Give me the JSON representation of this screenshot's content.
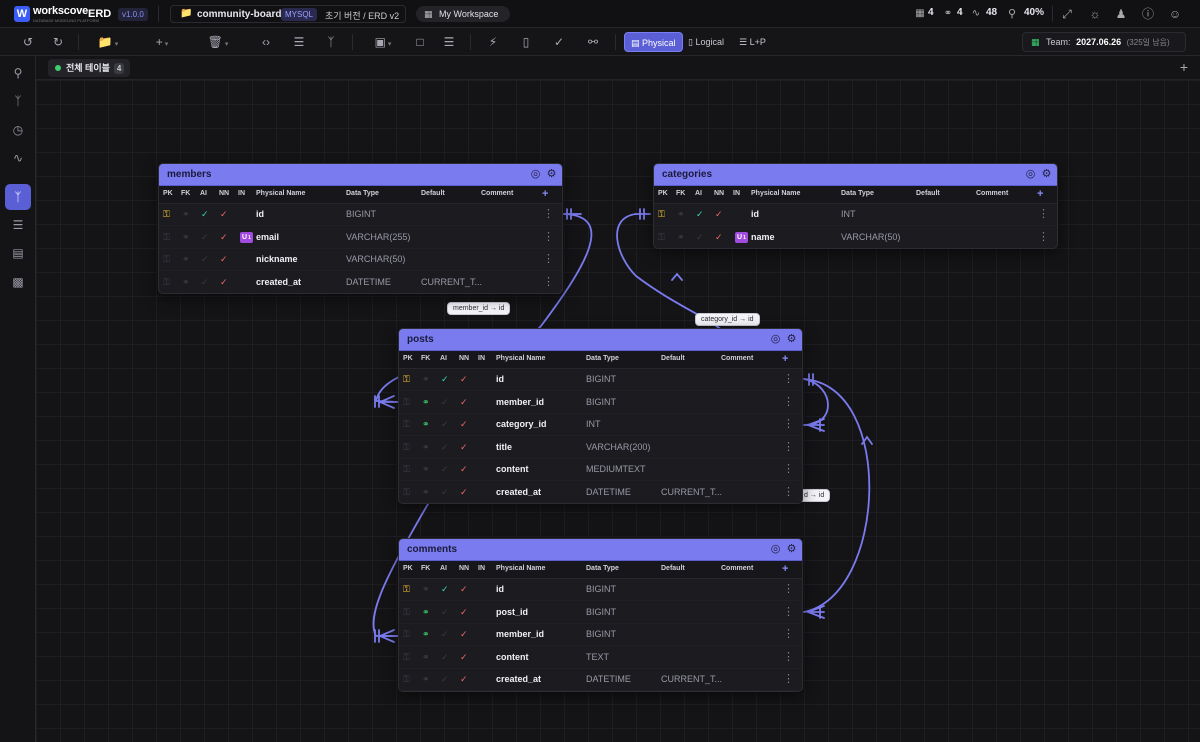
{
  "app": {
    "brand": "workscove",
    "brand_sub": "DATABASE MODELING PLATFORM",
    "erd": "ERD",
    "version": "v1.0.0"
  },
  "project": {
    "name": "community-board",
    "db": "MYSQL",
    "version": "초기 버전 / ERD v2",
    "workspace": "My Workspace"
  },
  "stats": {
    "tables": "4",
    "relations": "4",
    "activity": "48",
    "zoom": "40%"
  },
  "view_modes": [
    "Physical",
    "Logical",
    "L+P"
  ],
  "team": {
    "label": "Team:",
    "date": "2027.06.26",
    "remain": "(325일 남음)"
  },
  "tab": {
    "label": "전체 테이블",
    "count": "4"
  },
  "icons": {
    "pk": "key-icon",
    "fk": "link-icon",
    "check": "check-icon"
  },
  "colors": {
    "accent": "#7a7bef",
    "pk": "#f4c430",
    "fk": "#3ccf6e",
    "nn": "#f06a6a",
    "ai": "#3fd4b0"
  },
  "columns_header": [
    "PK",
    "FK",
    "AI",
    "NN",
    "IN",
    "Physical Name",
    "Data Type",
    "Default",
    "Comment"
  ],
  "relation_labels": [
    "member_id → id",
    "category_id → id",
    "d → id"
  ],
  "tables": {
    "members": {
      "name": "members",
      "rows": [
        {
          "name": "id",
          "type": "BIGINT",
          "default": ""
        },
        {
          "name": "email",
          "type": "VARCHAR(255)",
          "default": "",
          "uq": "U",
          "uqn": "1"
        },
        {
          "name": "nickname",
          "type": "VARCHAR(50)",
          "default": ""
        },
        {
          "name": "created_at",
          "type": "DATETIME",
          "default": "CURRENT_T..."
        }
      ]
    },
    "categories": {
      "name": "categories",
      "rows": [
        {
          "name": "id",
          "type": "INT",
          "default": ""
        },
        {
          "name": "name",
          "type": "VARCHAR(50)",
          "default": "",
          "uq": "U",
          "uqn": "1"
        }
      ]
    },
    "posts": {
      "name": "posts",
      "rows": [
        {
          "name": "id",
          "type": "BIGINT",
          "default": ""
        },
        {
          "name": "member_id",
          "type": "BIGINT",
          "default": ""
        },
        {
          "name": "category_id",
          "type": "INT",
          "default": ""
        },
        {
          "name": "title",
          "type": "VARCHAR(200)",
          "default": ""
        },
        {
          "name": "content",
          "type": "MEDIUMTEXT",
          "default": ""
        },
        {
          "name": "created_at",
          "type": "DATETIME",
          "default": "CURRENT_T..."
        }
      ]
    },
    "comments": {
      "name": "comments",
      "rows": [
        {
          "name": "id",
          "type": "BIGINT",
          "default": ""
        },
        {
          "name": "post_id",
          "type": "BIGINT",
          "default": ""
        },
        {
          "name": "member_id",
          "type": "BIGINT",
          "default": ""
        },
        {
          "name": "content",
          "type": "TEXT",
          "default": ""
        },
        {
          "name": "created_at",
          "type": "DATETIME",
          "default": "CURRENT_T..."
        }
      ]
    }
  }
}
